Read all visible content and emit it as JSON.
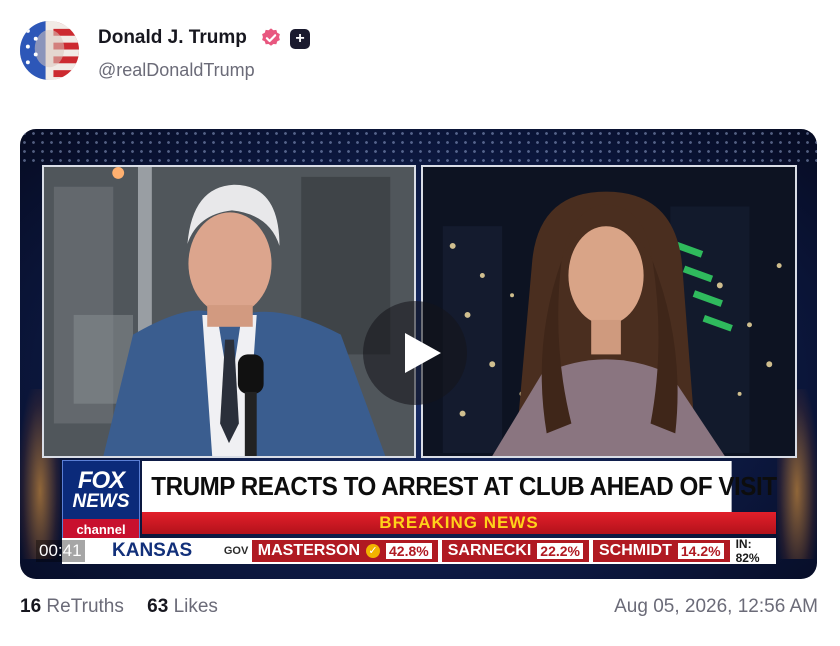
{
  "post": {
    "author_name": "Donald J. Trump",
    "author_handle": "@realDonaldTrump",
    "verified_icon": "verified-badge-icon",
    "plus_icon": "plus-icon",
    "plus_symbol": "+",
    "retruths_count": "16",
    "retruths_label": "ReTruths",
    "likes_count": "63",
    "likes_label": "Likes",
    "timestamp": "Aug 05, 2026, 12:56 AM"
  },
  "video": {
    "channel_logo_line1": "FOX",
    "channel_logo_line2": "NEWS",
    "channel_logo_line3": "channel",
    "headline": "TRUMP REACTS TO ARREST AT CLUB AHEAD OF VISIT",
    "breaking": "BREAKING NEWS",
    "time": "00:41",
    "ticker": {
      "state": "KANSAS",
      "race": "GOV",
      "candidates": [
        {
          "name": "MASTERSON",
          "pct": "42.8%",
          "check": "✓"
        },
        {
          "name": "SARNECKI",
          "pct": "22.2%"
        },
        {
          "name": "SCHMIDT",
          "pct": "14.2%"
        }
      ],
      "in_pct": "IN: 82%"
    },
    "play_icon": "play-icon"
  },
  "colors": {
    "accent_red": "#c8102e",
    "fox_blue": "#0b2a7a",
    "verified_pink": "#e8577f",
    "breaking_yellow": "#ffd21a"
  }
}
